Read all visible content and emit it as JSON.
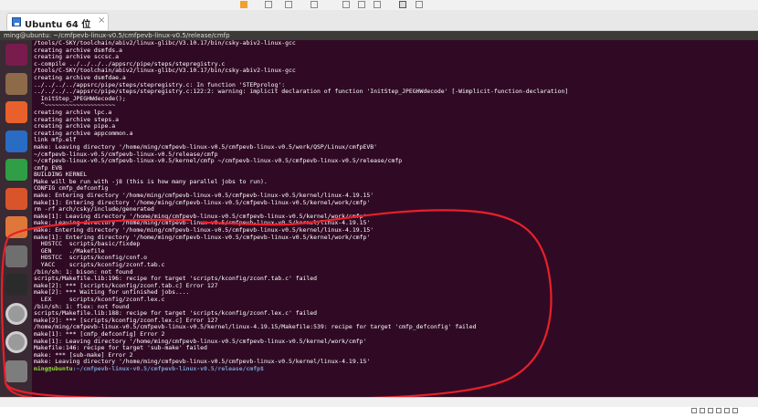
{
  "window": {
    "tab_label": "Ubuntu 64 位",
    "tab_close": "×"
  },
  "vm": {
    "titlebar": "ming@ubuntu: ~/cmfpevb-linux-v0.5/cmfpevb-linux-v0.5/release/cmfp"
  },
  "launcher": {
    "items": [
      {
        "name": "ubuntu-dash-icon",
        "color": "#7a1b4e"
      },
      {
        "name": "files-icon",
        "color": "#8c6a4a"
      },
      {
        "name": "firefox-icon",
        "color": "#e8612c"
      },
      {
        "name": "writer-icon",
        "color": "#2a6cc4"
      },
      {
        "name": "calc-icon",
        "color": "#2f9e44"
      },
      {
        "name": "impress-icon",
        "color": "#d9542b"
      },
      {
        "name": "software-center-icon",
        "color": "#e0773a"
      },
      {
        "name": "system-settings-icon",
        "color": "#6f6f6f"
      },
      {
        "name": "terminal-icon",
        "color": "#2b2b2b"
      },
      {
        "name": "dvd-icon",
        "color": "#9a9a9a"
      },
      {
        "name": "dvd-icon-2",
        "color": "#9a9a9a"
      },
      {
        "name": "trash-icon",
        "color": "#7d7d7d"
      }
    ]
  },
  "terminal": {
    "lines": [
      "/tools/C-SKY/toolchain/abiv2/linux-glibc/V3.10.17/bin/csky-abiv2-linux-gcc",
      "creating archive dsmfds.a",
      "creating archive sccsc.a",
      "c-compile ../../../../appsrc/pipe/steps/stepregistry.c",
      "/tools/C-SKY/toolchain/abiv2/linux-glibc/V3.10.17/bin/csky-abiv2-linux-gcc",
      "creating archive dsmfdae.a",
      "../../../../appsrc/pipe/steps/stepregistry.c: In function 'STEPprolog':",
      "../../../../appsrc/pipe/steps/stepregistry.c:122:2: warning: implicit declaration of function 'InitStep_JPEGHWdecode' [-Wimplicit-function-declaration]",
      "  InitStep_JPEGHWdecode();",
      "  ^~~~~~~~~~~~~~~~~~~~~",
      "creating archive lpc.a",
      "creating archive steps.a",
      "creating archive pipe.a",
      "creating archive appcommon.a",
      "link mfp.elf",
      "make: Leaving directory '/home/ming/cmfpevb-linux-v0.5/cmfpevb-linux-v0.5/work/QSP/Linux/cmfpEVB'",
      "~/cmfpevb-linux-v0.5/cmfpevb-linux-v0.5/release/cmfp",
      "~/cmfpevb-linux-v0.5/cmfpevb-linux-v0.5/kernel/cmfp ~/cmfpevb-linux-v0.5/cmfpevb-linux-v0.5/release/cmfp",
      "cmfp EVB",
      "BUILDING KERNEL",
      "Make will be run with -j8 (this is how many parallel jobs to run).",
      "CONFIG cmfp_defconfig",
      "make: Entering directory '/home/ming/cmfpevb-linux-v0.5/cmfpevb-linux-v0.5/kernel/linux-4.19.15'",
      "make[1]: Entering directory '/home/ming/cmfpevb-linux-v0.5/cmfpevb-linux-v0.5/kernel/work/cmfp'",
      "rm -rf arch/csky/include/generated",
      "make[1]: Leaving directory '/home/ming/cmfpevb-linux-v0.5/cmfpevb-linux-v0.5/kernel/work/cmfp'",
      "make: Leaving directory '/home/ming/cmfpevb-linux-v0.5/cmfpevb-linux-v0.5/kernel/linux-4.19.15'",
      "make: Entering directory '/home/ming/cmfpevb-linux-v0.5/cmfpevb-linux-v0.5/kernel/linux-4.19.15'",
      "make[1]: Entering directory '/home/ming/cmfpevb-linux-v0.5/cmfpevb-linux-v0.5/kernel/work/cmfp'",
      "  HOSTCC  scripts/basic/fixdep",
      "  GEN     ./Makefile",
      "  HOSTCC  scripts/kconfig/conf.o",
      "  YACC    scripts/kconfig/zconf.tab.c",
      "/bin/sh: 1: bison: not found",
      "scripts/Makefile.lib:196: recipe for target 'scripts/kconfig/zconf.tab.c' failed",
      "make[2]: *** [scripts/kconfig/zconf.tab.c] Error 127",
      "make[2]: *** Waiting for unfinished jobs....",
      "  LEX     scripts/kconfig/zconf.lex.c",
      "/bin/sh: 1: flex: not found",
      "scripts/Makefile.lib:188: recipe for target 'scripts/kconfig/zconf.lex.c' failed",
      "make[2]: *** [scripts/kconfig/zconf.lex.c] Error 127",
      "/home/ming/cmfpevb-linux-v0.5/cmfpevb-linux-v0.5/kernel/linux-4.19.15/Makefile:539: recipe for target 'cmfp_defconfig' failed",
      "make[1]: *** [cmfp_defconfig] Error 2",
      "make[1]: Leaving directory '/home/ming/cmfpevb-linux-v0.5/cmfpevb-linux-v0.5/kernel/work/cmfp'",
      "Makefile:146: recipe for target 'sub-make' failed",
      "make: *** [sub-make] Error 2",
      "make: Leaving directory '/home/ming/cmfpevb-linux-v0.5/cmfpevb-linux-v0.5/kernel/linux-4.19.15'"
    ],
    "prompt_user": "ming@ubuntu",
    "prompt_path": ":~/cmfpevb-linux-v0.5/cmfpevb-linux-v0.5/release/cmfp$"
  },
  "annotation": {
    "color": "#e8202a"
  }
}
